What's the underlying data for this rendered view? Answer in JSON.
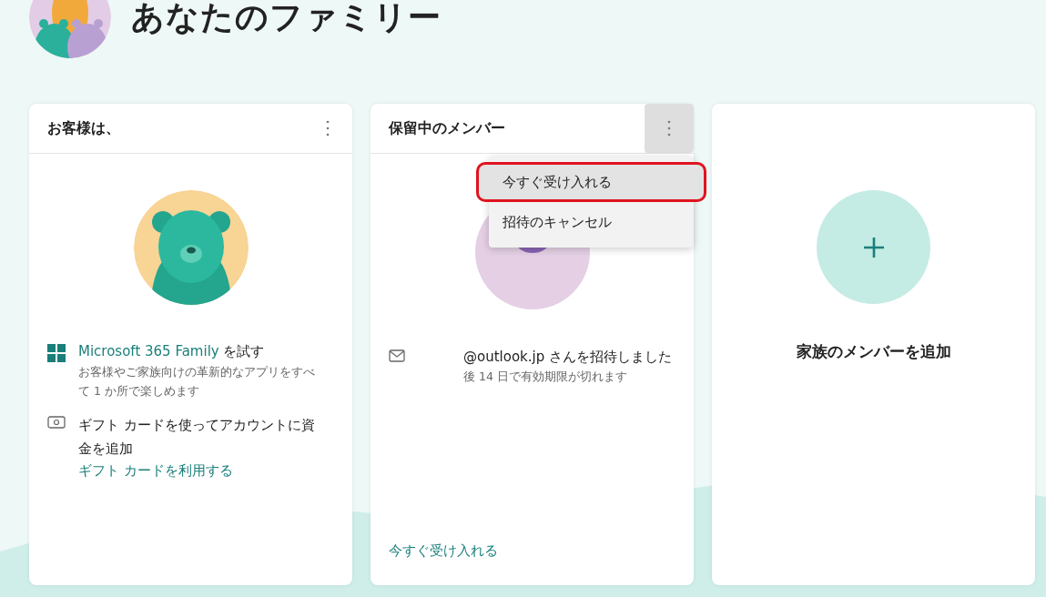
{
  "page_title": "あなたのファミリー",
  "cards": [
    {
      "title": "お客様は、",
      "items": [
        {
          "kind": "windows",
          "link": "Microsoft 365 Family",
          "text": " を試す",
          "note": "お客様やご家族向けの革新的なアプリをすべて 1 か所で楽しめます"
        },
        {
          "kind": "gift",
          "text": "ギフト カードを使ってアカウントに資金を追加",
          "link": "ギフト カードを利用する"
        }
      ]
    },
    {
      "title": "保留中のメンバー",
      "menu_open": true,
      "menu": [
        {
          "label": "今すぐ受け入れる",
          "selected": true,
          "circled": true
        },
        {
          "label": "招待のキャンセル",
          "selected": false,
          "circled": false
        }
      ],
      "invite": "@outlook.jp さんを招待しました",
      "expiry": "後 14 日で有効期限が切れます",
      "action": "今すぐ受け入れる"
    },
    {
      "label": "家族のメンバーを追加"
    }
  ]
}
